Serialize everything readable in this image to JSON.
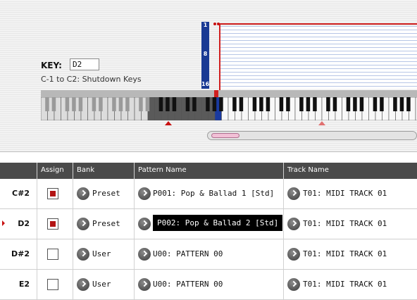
{
  "key_panel": {
    "key_label": "KEY:",
    "key_value": "D2",
    "range_note": "C-1 to C2: Shutdown Keys"
  },
  "velocity_scale": {
    "top": "1",
    "mid": "8",
    "bottom": "16"
  },
  "table": {
    "headers": [
      "Assign",
      "Bank",
      "Pattern Name",
      "Track Name"
    ],
    "rows": [
      {
        "key": "C#2",
        "assign": true,
        "bank": "Preset",
        "pattern": "P001: Pop & Ballad 1 [Std]",
        "track": "T01: MIDI TRACK 01",
        "selected": false
      },
      {
        "key": "D2",
        "assign": true,
        "bank": "Preset",
        "pattern": "P002: Pop & Ballad 2 [Std]",
        "track": "T01: MIDI TRACK 01",
        "selected": true
      },
      {
        "key": "D#2",
        "assign": false,
        "bank": "User",
        "pattern": "U00: PATTERN 00",
        "track": "T01: MIDI TRACK 01",
        "selected": false
      },
      {
        "key": "E2",
        "assign": false,
        "bank": "User",
        "pattern": "U00: PATTERN 00",
        "track": "T01: MIDI TRACK 01",
        "selected": false
      }
    ]
  },
  "colors": {
    "accent_red": "#c81010",
    "velocity_blue": "#1a3a94",
    "header_gray": "#4a4a4a"
  }
}
